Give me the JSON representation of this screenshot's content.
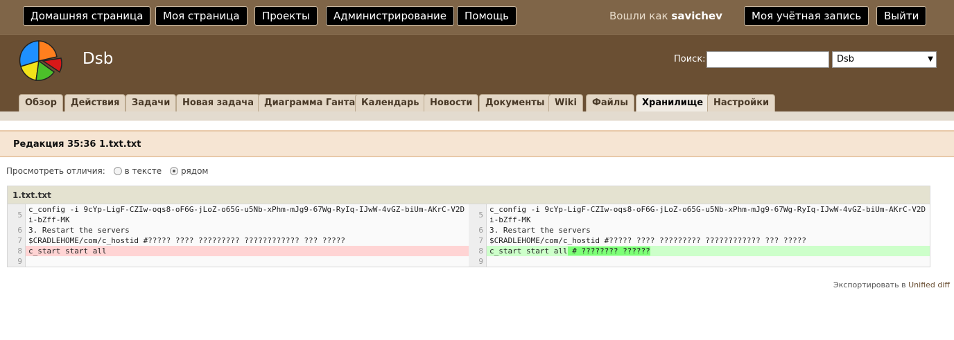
{
  "top_menu": {
    "items": [
      "Домашняя страница",
      "Моя страница",
      "Проекты",
      "Администрирование",
      "Помощь"
    ],
    "logged_as_prefix": "Вошли как",
    "user": "savichev",
    "account": "Моя учётная запись",
    "logout": "Выйти"
  },
  "header": {
    "project": "Dsb",
    "search_label": "Поиск:",
    "search_value": "",
    "project_select": "Dsb",
    "arrow": "▼"
  },
  "tabs": [
    "Обзор",
    "Действия",
    "Задачи",
    "Новая задача",
    "Диаграмма Ганта",
    "Календарь",
    "Новости",
    "Документы",
    "Wiki",
    "Файлы",
    "Хранилище",
    "Настройки"
  ],
  "selected_tab": "Хранилище",
  "revision": {
    "title": "Редакция 35:36 1.txt.txt"
  },
  "view_options": {
    "label": "Просмотреть отличия:",
    "inline": "в тексте",
    "side_by_side": "рядом",
    "selected": "side_by_side"
  },
  "diff": {
    "file": "1.txt.txt",
    "left": [
      {
        "n": "5",
        "text": "c_config -i 9cYp-LigF-CZIw-oqs8-oF6G-jLoZ-o65G-u5Nb-xPhm-mJg9-67Wg-RyIq-IJwW-4vGZ-biUm-AKrC-V2Di-bZff-MK",
        "type": "ctx"
      },
      {
        "n": "6",
        "text": "3. Restart the servers",
        "type": "ctx"
      },
      {
        "n": "7",
        "text": "$CRADLEHOME/com/c_hostid #????? ???? ????????? ???????????? ??? ?????",
        "type": "ctx"
      },
      {
        "n": "8",
        "text": "c_start start all",
        "type": "del"
      },
      {
        "n": "9",
        "text": "",
        "type": "ctx"
      }
    ],
    "right": [
      {
        "n": "5",
        "text": "c_config -i 9cYp-LigF-CZIw-oqs8-oF6G-jLoZ-o65G-u5Nb-xPhm-mJg9-67Wg-RyIq-IJwW-4vGZ-biUm-AKrC-V2Di-bZff-MK",
        "type": "ctx"
      },
      {
        "n": "6",
        "text": "3. Restart the servers",
        "type": "ctx"
      },
      {
        "n": "7",
        "text": "$CRADLEHOME/com/c_hostid #????? ???? ????????? ???????????? ??? ?????",
        "type": "ctx"
      },
      {
        "n": "8",
        "text": "c_start start all",
        "added": " # ???????? ??????",
        "type": "add"
      },
      {
        "n": "9",
        "text": "",
        "type": "ctx"
      }
    ]
  },
  "export": {
    "prefix": "Экспортировать в",
    "link": "Unified diff"
  },
  "colors": {
    "top_bar": "#7f6548",
    "header": "#6a4f33",
    "revision_bar": "#f6e5d3",
    "deleted": "#ffd4d4",
    "added": "#cdffca"
  }
}
